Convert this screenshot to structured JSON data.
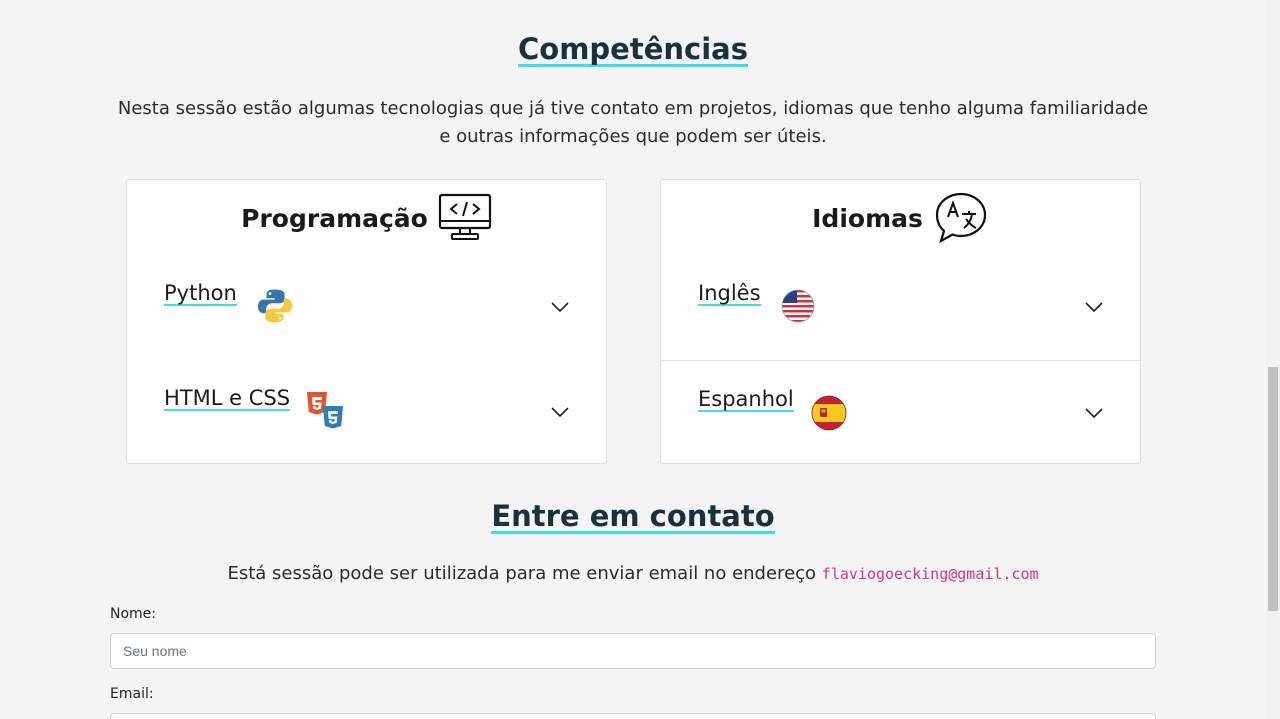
{
  "competencias": {
    "title": "Competências",
    "intro": "Nesta sessão estão algumas tecnologias que já tive contato em projetos, idiomas que tenho alguma familiaridade e outras informações que podem ser úteis.",
    "cards": {
      "programacao": {
        "title": "Programação",
        "icon": "code-monitor-icon",
        "items": [
          {
            "label": "Python",
            "icon": "python-logo-icon"
          },
          {
            "label": "HTML e CSS",
            "icon": "html-css-logo-icon"
          }
        ]
      },
      "idiomas": {
        "title": "Idiomas",
        "icon": "translate-bubble-icon",
        "items": [
          {
            "label": "Inglês",
            "icon": "usa-flag-icon"
          },
          {
            "label": "Espanhol",
            "icon": "spain-flag-icon"
          }
        ]
      }
    }
  },
  "contato": {
    "title": "Entre em contato",
    "text": "Está sessão pode ser utilizada para me enviar email no endereço",
    "email": "flaviogoecking@gmail.com",
    "form": {
      "name_label": "Nome:",
      "name_placeholder": "Seu nome",
      "email_label": "Email:",
      "email_placeholder": ""
    }
  },
  "colors": {
    "accent_underline": "#35e2ea",
    "heading": "#17313d",
    "code": "#d63384",
    "background": "#f4f4f4"
  }
}
